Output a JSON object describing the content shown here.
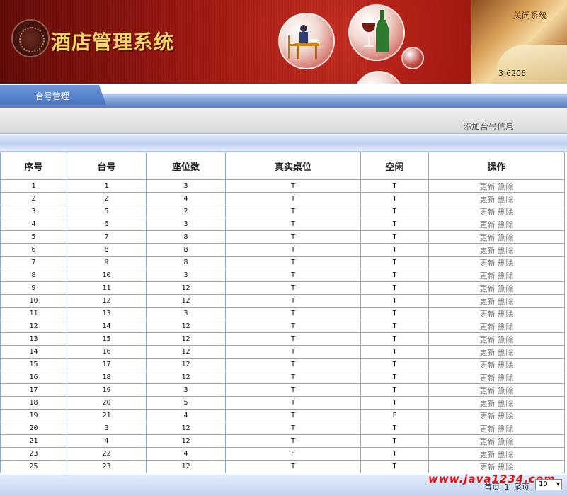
{
  "header": {
    "title": "酒店管理系统",
    "top_link": "关闭系统",
    "code": "3-6206"
  },
  "tab": {
    "label": "台号管理"
  },
  "actions": {
    "add_label": "添加台号信息"
  },
  "table": {
    "columns": [
      "序号",
      "台号",
      "座位数",
      "真实桌位",
      "空闲",
      "操作"
    ],
    "update_label": "更新",
    "delete_label": "删除",
    "rows": [
      [
        "1",
        "1",
        "3",
        "T",
        "T"
      ],
      [
        "2",
        "2",
        "4",
        "T",
        "T"
      ],
      [
        "3",
        "5",
        "2",
        "T",
        "T"
      ],
      [
        "4",
        "6",
        "3",
        "T",
        "T"
      ],
      [
        "5",
        "7",
        "8",
        "T",
        "T"
      ],
      [
        "6",
        "8",
        "8",
        "T",
        "T"
      ],
      [
        "7",
        "9",
        "8",
        "T",
        "T"
      ],
      [
        "8",
        "10",
        "3",
        "T",
        "T"
      ],
      [
        "9",
        "11",
        "12",
        "T",
        "T"
      ],
      [
        "10",
        "12",
        "12",
        "T",
        "T"
      ],
      [
        "11",
        "13",
        "3",
        "T",
        "T"
      ],
      [
        "12",
        "14",
        "12",
        "T",
        "T"
      ],
      [
        "13",
        "15",
        "12",
        "T",
        "T"
      ],
      [
        "14",
        "16",
        "12",
        "T",
        "T"
      ],
      [
        "15",
        "17",
        "12",
        "T",
        "T"
      ],
      [
        "16",
        "18",
        "12",
        "T",
        "T"
      ],
      [
        "17",
        "19",
        "3",
        "T",
        "T"
      ],
      [
        "18",
        "20",
        "5",
        "T",
        "T"
      ],
      [
        "19",
        "21",
        "4",
        "T",
        "F"
      ],
      [
        "20",
        "3",
        "12",
        "T",
        "T"
      ],
      [
        "21",
        "4",
        "12",
        "T",
        "T"
      ],
      [
        "23",
        "22",
        "4",
        "F",
        "T"
      ],
      [
        "25",
        "23",
        "12",
        "T",
        "T"
      ]
    ]
  },
  "footer": {
    "watermark": "www.java1234.com",
    "first": "首页",
    "page": "1",
    "last": "尾页",
    "page_size": "10"
  }
}
